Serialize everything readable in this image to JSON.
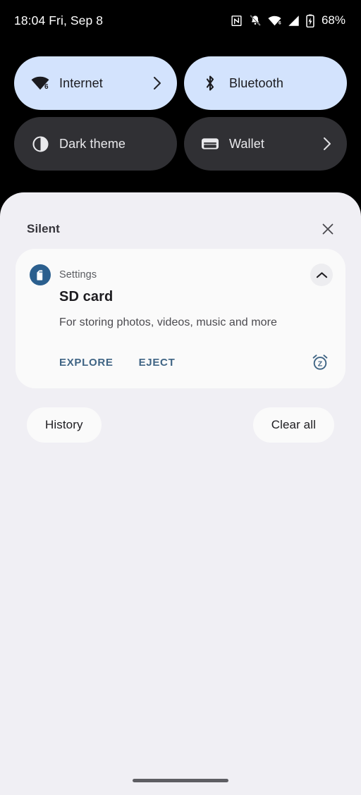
{
  "status_bar": {
    "clock": "18:04 Fri, Sep 8",
    "battery_percent": "68%",
    "icons": [
      "nfc-icon",
      "notifications-muted-icon",
      "wifi-icon",
      "cellular-signal-icon",
      "battery-icon"
    ],
    "wifi_badge": "6",
    "text_color": "#ffffff"
  },
  "quick_settings": {
    "tiles": [
      {
        "label": "Internet",
        "icon": "wifi-icon",
        "state": "active",
        "has_chevron": true,
        "badge": "6"
      },
      {
        "label": "Bluetooth",
        "icon": "bluetooth-icon",
        "state": "active",
        "has_chevron": false
      },
      {
        "label": "Dark theme",
        "icon": "contrast-icon",
        "state": "inactive",
        "has_chevron": false
      },
      {
        "label": "Wallet",
        "icon": "wallet-icon",
        "state": "inactive",
        "has_chevron": true
      }
    ],
    "active_color": "#d3e3fd",
    "inactive_color": "#303034"
  },
  "shade": {
    "section_title": "Silent",
    "close_icon": "close-icon",
    "background": "#f0eff4",
    "notification": {
      "app_name": "Settings",
      "app_icon": "sd-card-icon",
      "app_icon_color": "#2b5f8e",
      "title": "SD card",
      "body": "For storing photos, videos, music and more",
      "expand_icon": "chevron-up-icon",
      "snooze_icon": "snooze-alarm-icon",
      "actions": [
        {
          "label": "EXPLORE"
        },
        {
          "label": "EJECT"
        }
      ],
      "action_color": "#3f6484"
    },
    "footer_buttons": [
      {
        "label": "History"
      },
      {
        "label": "Clear all"
      }
    ]
  },
  "navigation": {
    "handle": "gesture-nav-handle"
  }
}
